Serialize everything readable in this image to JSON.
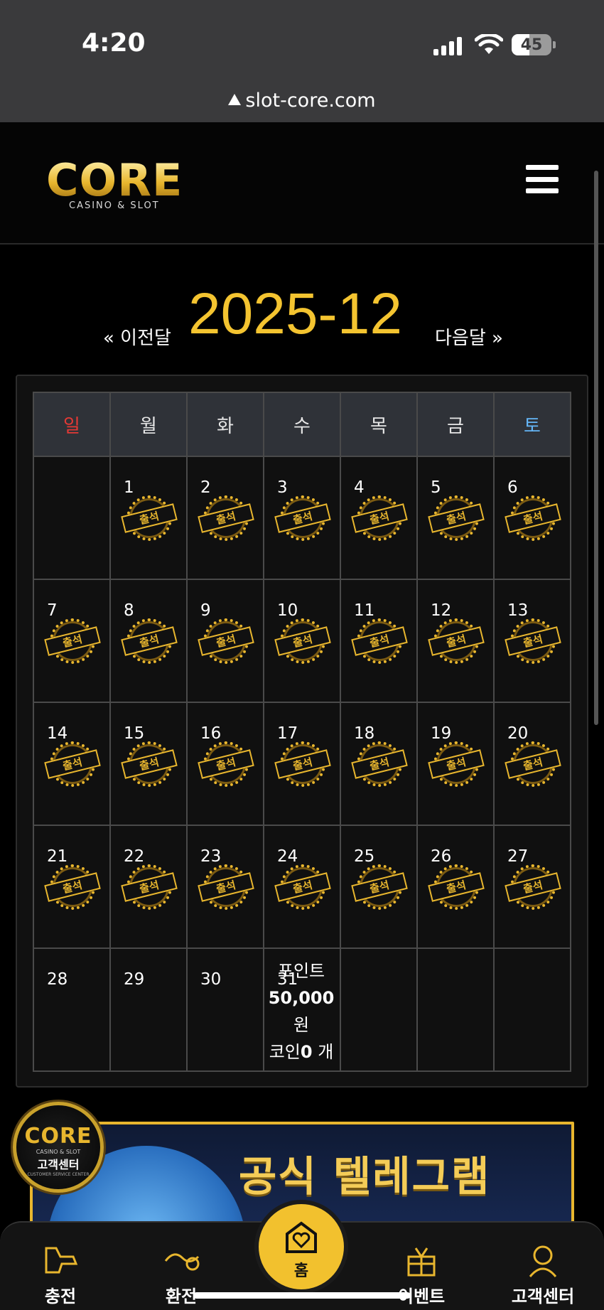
{
  "status_bar": {
    "time": "4:20",
    "battery": "45",
    "battery_level": 0.45
  },
  "browser": {
    "url": "slot-core.com"
  },
  "header": {
    "logo_main": "CORE",
    "logo_sub": "CASINO & SLOT"
  },
  "calendar": {
    "prev_label": "« 이전달",
    "next_label": "다음달 »",
    "month": "2025-12",
    "weekdays": [
      "일",
      "월",
      "화",
      "수",
      "목",
      "금",
      "토"
    ],
    "weekday_colors": [
      "#e53935",
      "#e6e6e6",
      "#e6e6e6",
      "#e6e6e6",
      "#e6e6e6",
      "#e6e6e6",
      "#64b5f6"
    ],
    "stamp_label": "출석",
    "days": [
      "1",
      "2",
      "3",
      "4",
      "5",
      "6",
      "7",
      "8",
      "9",
      "10",
      "11",
      "12",
      "13",
      "14",
      "15",
      "16",
      "17",
      "18",
      "19",
      "20",
      "21",
      "22",
      "23",
      "24",
      "25",
      "26",
      "27",
      "28",
      "29",
      "30",
      "31"
    ],
    "summary": {
      "point_label": "포인트",
      "point_value": "50,000",
      "won": "원",
      "coin_label": "코인",
      "coin_value": "0",
      "coin_unit": "개"
    }
  },
  "banner": {
    "title": "공식 텔레그램"
  },
  "cs_badge": {
    "brand": "CORE",
    "sub": "CASINO & SLOT",
    "title": "고객센터",
    "tag": "CUSTOMER SERVICE CENTER"
  },
  "bottom_nav": {
    "charge": "충전",
    "exchange": "환전",
    "home": "홈",
    "event": "이벤트",
    "support": "고객센터"
  },
  "colors": {
    "accent": "#f4c430",
    "background": "#000000"
  }
}
